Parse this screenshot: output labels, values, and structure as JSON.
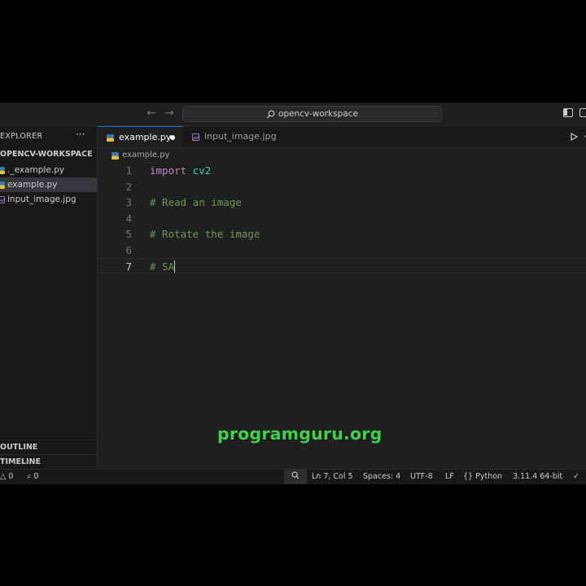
{
  "titlebar": {
    "search_text": "opencv-workspace"
  },
  "sidebar": {
    "title": "EXPLORER",
    "more": "···",
    "folder": "OPENCV-WORKSPACE",
    "files": [
      {
        "name": "._example.py"
      },
      {
        "name": "example.py"
      },
      {
        "name": "input_image.jpg"
      }
    ],
    "outline": "OUTLINE",
    "timeline": "TIMELINE"
  },
  "tabs": [
    {
      "label": "example.py"
    },
    {
      "label": "input_image.jpg"
    }
  ],
  "breadcrumb": {
    "file": "example.py"
  },
  "editor": {
    "lines": [
      {
        "num": "1",
        "kw": "import",
        "mod": "cv2"
      },
      {
        "num": "2"
      },
      {
        "num": "3",
        "comment": "# Read an image"
      },
      {
        "num": "4"
      },
      {
        "num": "5",
        "comment": "# Rotate the image"
      },
      {
        "num": "6"
      },
      {
        "num": "7",
        "comment": "# SA"
      }
    ]
  },
  "watermark": "programguru.org",
  "statusbar": {
    "errors": "0",
    "warnings": "0",
    "position": "Ln 7, Col 5",
    "spaces": "Spaces: 4",
    "encoding": "UTF-8",
    "eol": "LF",
    "language": "Python",
    "interpreter": "3.11.4 64-bit"
  },
  "colors": {
    "accent": "#0078d4",
    "keyword": "#c586c0",
    "module": "#4ec9b0",
    "comment": "#6a9955",
    "watermark": "#3fd14a"
  }
}
